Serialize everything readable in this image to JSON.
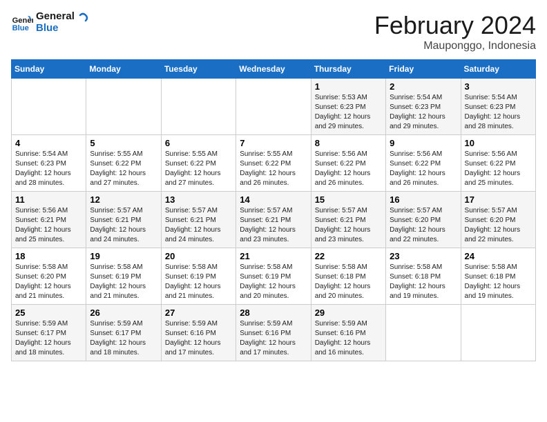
{
  "header": {
    "logo_text_general": "General",
    "logo_text_blue": "Blue",
    "month": "February 2024",
    "location": "Mauponggo, Indonesia"
  },
  "calendar": {
    "weekdays": [
      "Sunday",
      "Monday",
      "Tuesday",
      "Wednesday",
      "Thursday",
      "Friday",
      "Saturday"
    ],
    "weeks": [
      [
        {
          "day": "",
          "info": ""
        },
        {
          "day": "",
          "info": ""
        },
        {
          "day": "",
          "info": ""
        },
        {
          "day": "",
          "info": ""
        },
        {
          "day": "1",
          "info": "Sunrise: 5:53 AM\nSunset: 6:23 PM\nDaylight: 12 hours\nand 29 minutes."
        },
        {
          "day": "2",
          "info": "Sunrise: 5:54 AM\nSunset: 6:23 PM\nDaylight: 12 hours\nand 29 minutes."
        },
        {
          "day": "3",
          "info": "Sunrise: 5:54 AM\nSunset: 6:23 PM\nDaylight: 12 hours\nand 28 minutes."
        }
      ],
      [
        {
          "day": "4",
          "info": "Sunrise: 5:54 AM\nSunset: 6:23 PM\nDaylight: 12 hours\nand 28 minutes."
        },
        {
          "day": "5",
          "info": "Sunrise: 5:55 AM\nSunset: 6:22 PM\nDaylight: 12 hours\nand 27 minutes."
        },
        {
          "day": "6",
          "info": "Sunrise: 5:55 AM\nSunset: 6:22 PM\nDaylight: 12 hours\nand 27 minutes."
        },
        {
          "day": "7",
          "info": "Sunrise: 5:55 AM\nSunset: 6:22 PM\nDaylight: 12 hours\nand 26 minutes."
        },
        {
          "day": "8",
          "info": "Sunrise: 5:56 AM\nSunset: 6:22 PM\nDaylight: 12 hours\nand 26 minutes."
        },
        {
          "day": "9",
          "info": "Sunrise: 5:56 AM\nSunset: 6:22 PM\nDaylight: 12 hours\nand 26 minutes."
        },
        {
          "day": "10",
          "info": "Sunrise: 5:56 AM\nSunset: 6:22 PM\nDaylight: 12 hours\nand 25 minutes."
        }
      ],
      [
        {
          "day": "11",
          "info": "Sunrise: 5:56 AM\nSunset: 6:21 PM\nDaylight: 12 hours\nand 25 minutes."
        },
        {
          "day": "12",
          "info": "Sunrise: 5:57 AM\nSunset: 6:21 PM\nDaylight: 12 hours\nand 24 minutes."
        },
        {
          "day": "13",
          "info": "Sunrise: 5:57 AM\nSunset: 6:21 PM\nDaylight: 12 hours\nand 24 minutes."
        },
        {
          "day": "14",
          "info": "Sunrise: 5:57 AM\nSunset: 6:21 PM\nDaylight: 12 hours\nand 23 minutes."
        },
        {
          "day": "15",
          "info": "Sunrise: 5:57 AM\nSunset: 6:21 PM\nDaylight: 12 hours\nand 23 minutes."
        },
        {
          "day": "16",
          "info": "Sunrise: 5:57 AM\nSunset: 6:20 PM\nDaylight: 12 hours\nand 22 minutes."
        },
        {
          "day": "17",
          "info": "Sunrise: 5:57 AM\nSunset: 6:20 PM\nDaylight: 12 hours\nand 22 minutes."
        }
      ],
      [
        {
          "day": "18",
          "info": "Sunrise: 5:58 AM\nSunset: 6:20 PM\nDaylight: 12 hours\nand 21 minutes."
        },
        {
          "day": "19",
          "info": "Sunrise: 5:58 AM\nSunset: 6:19 PM\nDaylight: 12 hours\nand 21 minutes."
        },
        {
          "day": "20",
          "info": "Sunrise: 5:58 AM\nSunset: 6:19 PM\nDaylight: 12 hours\nand 21 minutes."
        },
        {
          "day": "21",
          "info": "Sunrise: 5:58 AM\nSunset: 6:19 PM\nDaylight: 12 hours\nand 20 minutes."
        },
        {
          "day": "22",
          "info": "Sunrise: 5:58 AM\nSunset: 6:18 PM\nDaylight: 12 hours\nand 20 minutes."
        },
        {
          "day": "23",
          "info": "Sunrise: 5:58 AM\nSunset: 6:18 PM\nDaylight: 12 hours\nand 19 minutes."
        },
        {
          "day": "24",
          "info": "Sunrise: 5:58 AM\nSunset: 6:18 PM\nDaylight: 12 hours\nand 19 minutes."
        }
      ],
      [
        {
          "day": "25",
          "info": "Sunrise: 5:59 AM\nSunset: 6:17 PM\nDaylight: 12 hours\nand 18 minutes."
        },
        {
          "day": "26",
          "info": "Sunrise: 5:59 AM\nSunset: 6:17 PM\nDaylight: 12 hours\nand 18 minutes."
        },
        {
          "day": "27",
          "info": "Sunrise: 5:59 AM\nSunset: 6:16 PM\nDaylight: 12 hours\nand 17 minutes."
        },
        {
          "day": "28",
          "info": "Sunrise: 5:59 AM\nSunset: 6:16 PM\nDaylight: 12 hours\nand 17 minutes."
        },
        {
          "day": "29",
          "info": "Sunrise: 5:59 AM\nSunset: 6:16 PM\nDaylight: 12 hours\nand 16 minutes."
        },
        {
          "day": "",
          "info": ""
        },
        {
          "day": "",
          "info": ""
        }
      ]
    ]
  }
}
